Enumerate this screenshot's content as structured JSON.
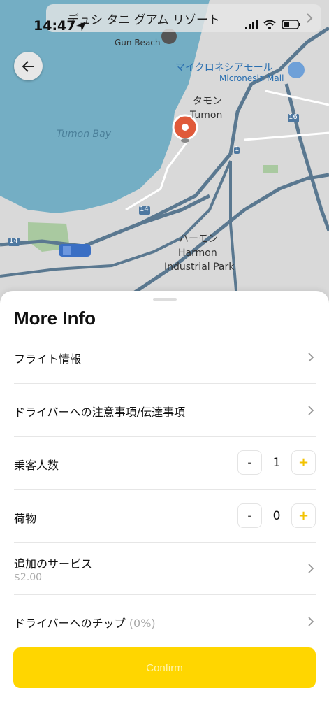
{
  "status": {
    "time": "14:47",
    "hotel_banner": "デュシ タニ グアム リゾート"
  },
  "map": {
    "gun_beach": "Gun Beach",
    "micronesia_mall_jp": "マイクロネシアモール",
    "micronesia_mall_en": "Micronesia Mall",
    "tumon_jp": "タモン",
    "tumon_en": "Tumon",
    "tumon_bay": "Tumon Bay",
    "harmon_jp": "ハーモン",
    "harmon_en": "Harmon",
    "harmon_park": "Industrial Park",
    "route_14_a": "14",
    "route_14_b": "14",
    "route_16": "16",
    "route_1": "1",
    "colors": {
      "water": "#74aec4",
      "land": "#d9d9d9",
      "road": "#5a7890",
      "pin": "#e05a3a",
      "car": "#3a6fc4"
    }
  },
  "sheet": {
    "title": "More Info",
    "rows": {
      "flight": {
        "label": "フライト情報"
      },
      "notes": {
        "label": "ドライバーへの注意事項/伝達事項"
      },
      "passengers": {
        "label": "乗客人数",
        "minus": "-",
        "value": "1",
        "plus": "+"
      },
      "luggage": {
        "label": "荷物",
        "minus": "-",
        "value": "0",
        "plus": "+"
      },
      "services": {
        "label": "追加のサービス",
        "price": "$2.00"
      },
      "tip": {
        "label": "ドライバーへのチップ",
        "percent": "(0%)"
      }
    },
    "confirm_label": "Confirm",
    "accent_color": "#ffd600"
  }
}
